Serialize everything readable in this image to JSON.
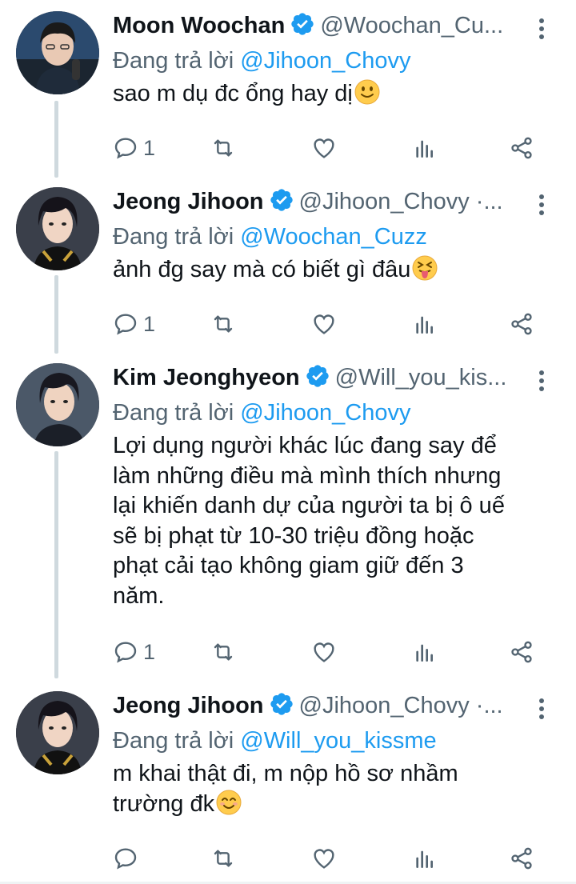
{
  "thread": {
    "tweets": [
      {
        "name": "Moon Woochan",
        "handle": "@Woochan_Cu...",
        "reply_prefix": "Đang trả lời ",
        "reply_to": "@Jihoon_Chovy",
        "text": "sao m dụ đc ổng hay dị",
        "emoji": "slightly-smiling-face",
        "reply_count": "1"
      },
      {
        "name": "Jeong Jihoon",
        "handle": "@Jihoon_Chovy ·...",
        "reply_prefix": "Đang trả lời ",
        "reply_to": "@Woochan_Cuzz",
        "text": "ảnh đg say mà có biết gì đâu",
        "emoji": "squinting-tongue-face",
        "reply_count": "1"
      },
      {
        "name": "Kim Jeonghyeon",
        "handle": "@Will_you_kis...",
        "reply_prefix": "Đang trả lời ",
        "reply_to": "@Jihoon_Chovy",
        "text_lines": [
          "Lợi dụng người khác lúc đang say để",
          "làm những điều mà mình thích nhưng",
          "lại khiến danh dự của người ta bị ô uế",
          "sẽ bị phạt từ 10-30 triệu đồng hoặc",
          "phạt cải tạo không giam giữ đến 3",
          "năm."
        ],
        "reply_count": "1"
      },
      {
        "name": "Jeong Jihoon",
        "handle": "@Jihoon_Chovy ·...",
        "reply_prefix": "Đang trả lời ",
        "reply_to": "@Will_you_kissme",
        "text_lines": [
          "m khai thật đi, m nộp hồ sơ nhầm",
          "trường đk"
        ],
        "emoji": "smiling-face-with-smiling-eyes",
        "reply_count": ""
      }
    ]
  },
  "colors": {
    "text": "#0f1419",
    "secondary": "#536471",
    "accent": "#1d9bf0",
    "thread_line": "#cfd9de"
  },
  "icons": {
    "verified": "verified-badge-icon",
    "more": "more-vertical-icon",
    "reply": "reply-icon",
    "retweet": "retweet-icon",
    "like": "heart-icon",
    "views": "views-icon",
    "share": "share-icon"
  }
}
